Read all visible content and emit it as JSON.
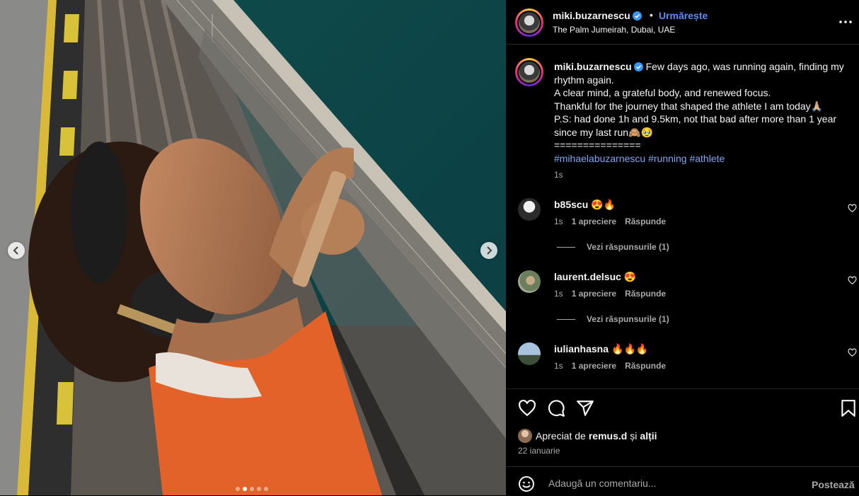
{
  "photo": {
    "active_slide": 2,
    "slide_count": 5,
    "prev_icon": "chevron-left-icon",
    "next_icon": "chevron-right-icon"
  },
  "header": {
    "username": "miki.buzarnescu",
    "separator": "•",
    "follow_label": "Urmărește",
    "location": "The Palm Jumeirah, Dubai, UAE",
    "more_icon": "more-horizontal-icon"
  },
  "caption": {
    "username": "miki.buzarnescu",
    "lines": [
      "Few days ago, was running again, finding my rhythm again.",
      "A clear mind, a grateful body, and renewed focus.",
      "Thankful for the journey that shaped the athlete I am today🙏🏼",
      "P.S: had done 1h and 9.5km, not that bad after more than 1 year since my last run🙈🥹",
      "==============="
    ],
    "hashtags": "#mihaelabuzarnescu #running #athlete",
    "time": "1s"
  },
  "comments": [
    {
      "username": "b85scu",
      "text": "😍🔥",
      "time": "1s",
      "likes": "1 apreciere",
      "reply": "Răspunde",
      "view_replies": "Vezi răspunsurile (1)"
    },
    {
      "username": "laurent.delsuc",
      "text": "😍",
      "time": "1s",
      "likes": "1 apreciere",
      "reply": "Răspunde",
      "view_replies": "Vezi răspunsurile (1)"
    },
    {
      "username": "iulianhasna",
      "text": "🔥🔥🔥",
      "time": "1s",
      "likes": "1 apreciere",
      "reply": "Răspunde",
      "view_replies": ""
    }
  ],
  "actions": {
    "like_icon": "heart-icon",
    "comment_icon": "comment-icon",
    "share_icon": "share-icon",
    "save_icon": "bookmark-icon"
  },
  "likes": {
    "prefix": "Apreciat de",
    "user": "remus.d",
    "middle": "și",
    "suffix": "alții"
  },
  "date": "22 ianuarie",
  "add_comment": {
    "placeholder": "Adaugă un comentariu...",
    "post_label": "Postează",
    "emoji_icon": "emoji-icon"
  },
  "colors": {
    "accent": "#5b8cf5",
    "hashtag": "#7fa6f2",
    "secondary_text": "#a8a8a8",
    "background": "#000000"
  }
}
